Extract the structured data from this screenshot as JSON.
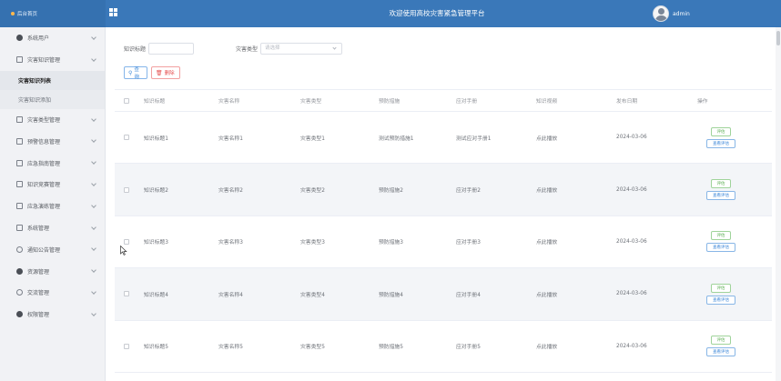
{
  "header": {
    "logo_text": "后台首页",
    "title": "欢迎使用高校灾害紧急管理平台",
    "user": "admin"
  },
  "sidebar": {
    "items": [
      {
        "label": "系统用户",
        "icon": "user-icon"
      },
      {
        "label": "灾害知识管理",
        "icon": "doc-icon",
        "sub": [
          {
            "label": "灾害知识列表",
            "active": true
          },
          {
            "label": "灾害知识添加",
            "active": false
          }
        ]
      },
      {
        "label": "灾害类型管理",
        "icon": "doc-icon"
      },
      {
        "label": "预警信息管理",
        "icon": "doc-icon"
      },
      {
        "label": "应急指南管理",
        "icon": "doc-icon"
      },
      {
        "label": "知识竞赛管理",
        "icon": "doc-icon"
      },
      {
        "label": "应急演练管理",
        "icon": "doc-icon"
      },
      {
        "label": "系统管理",
        "icon": "calendar-icon"
      },
      {
        "label": "通知公告管理",
        "icon": "info-icon"
      },
      {
        "label": "资源管理",
        "icon": "location-icon"
      },
      {
        "label": "交流管理",
        "icon": "chat-icon"
      },
      {
        "label": "权限管理",
        "icon": "user-icon"
      }
    ]
  },
  "filters": {
    "title_label": "知识标题",
    "type_label": "灾害类型",
    "type_placeholder": "请选择"
  },
  "buttons": {
    "search": "查询",
    "delete": "删除"
  },
  "table": {
    "headers": [
      "知识标题",
      "灾害名称",
      "灾害类型",
      "预防措施",
      "应对手册",
      "知识视频",
      "发布日期",
      "操作"
    ],
    "rows": [
      {
        "title": "知识标题1",
        "name": "灾害名称1",
        "type": "灾害类型1",
        "prevent": "测试预防措施1",
        "manual": "测试应对手册1",
        "video": "点此播放",
        "date": "2024-03-06"
      },
      {
        "title": "知识标题2",
        "name": "灾害名称2",
        "type": "灾害类型2",
        "prevent": "预防措施2",
        "manual": "应对手册2",
        "video": "点此播放",
        "date": "2024-03-06"
      },
      {
        "title": "知识标题3",
        "name": "灾害名称3",
        "type": "灾害类型3",
        "prevent": "预防措施3",
        "manual": "应对手册3",
        "video": "点此播放",
        "date": "2024-03-06"
      },
      {
        "title": "知识标题4",
        "name": "灾害名称4",
        "type": "灾害类型4",
        "prevent": "预防措施4",
        "manual": "应对手册4",
        "video": "点此播放",
        "date": "2024-03-06"
      },
      {
        "title": "知识标题5",
        "name": "灾害名称5",
        "type": "灾害类型5",
        "prevent": "预防措施5",
        "manual": "应对手册5",
        "video": "点此播放",
        "date": "2024-03-06"
      }
    ],
    "op_eval": "评估",
    "op_view": "查看评估"
  },
  "colors": {
    "header": "#3a78b9",
    "sidebar": "#f1f2f5",
    "primary": "#3a86d8",
    "danger": "#e55050",
    "success": "#5bae52"
  }
}
